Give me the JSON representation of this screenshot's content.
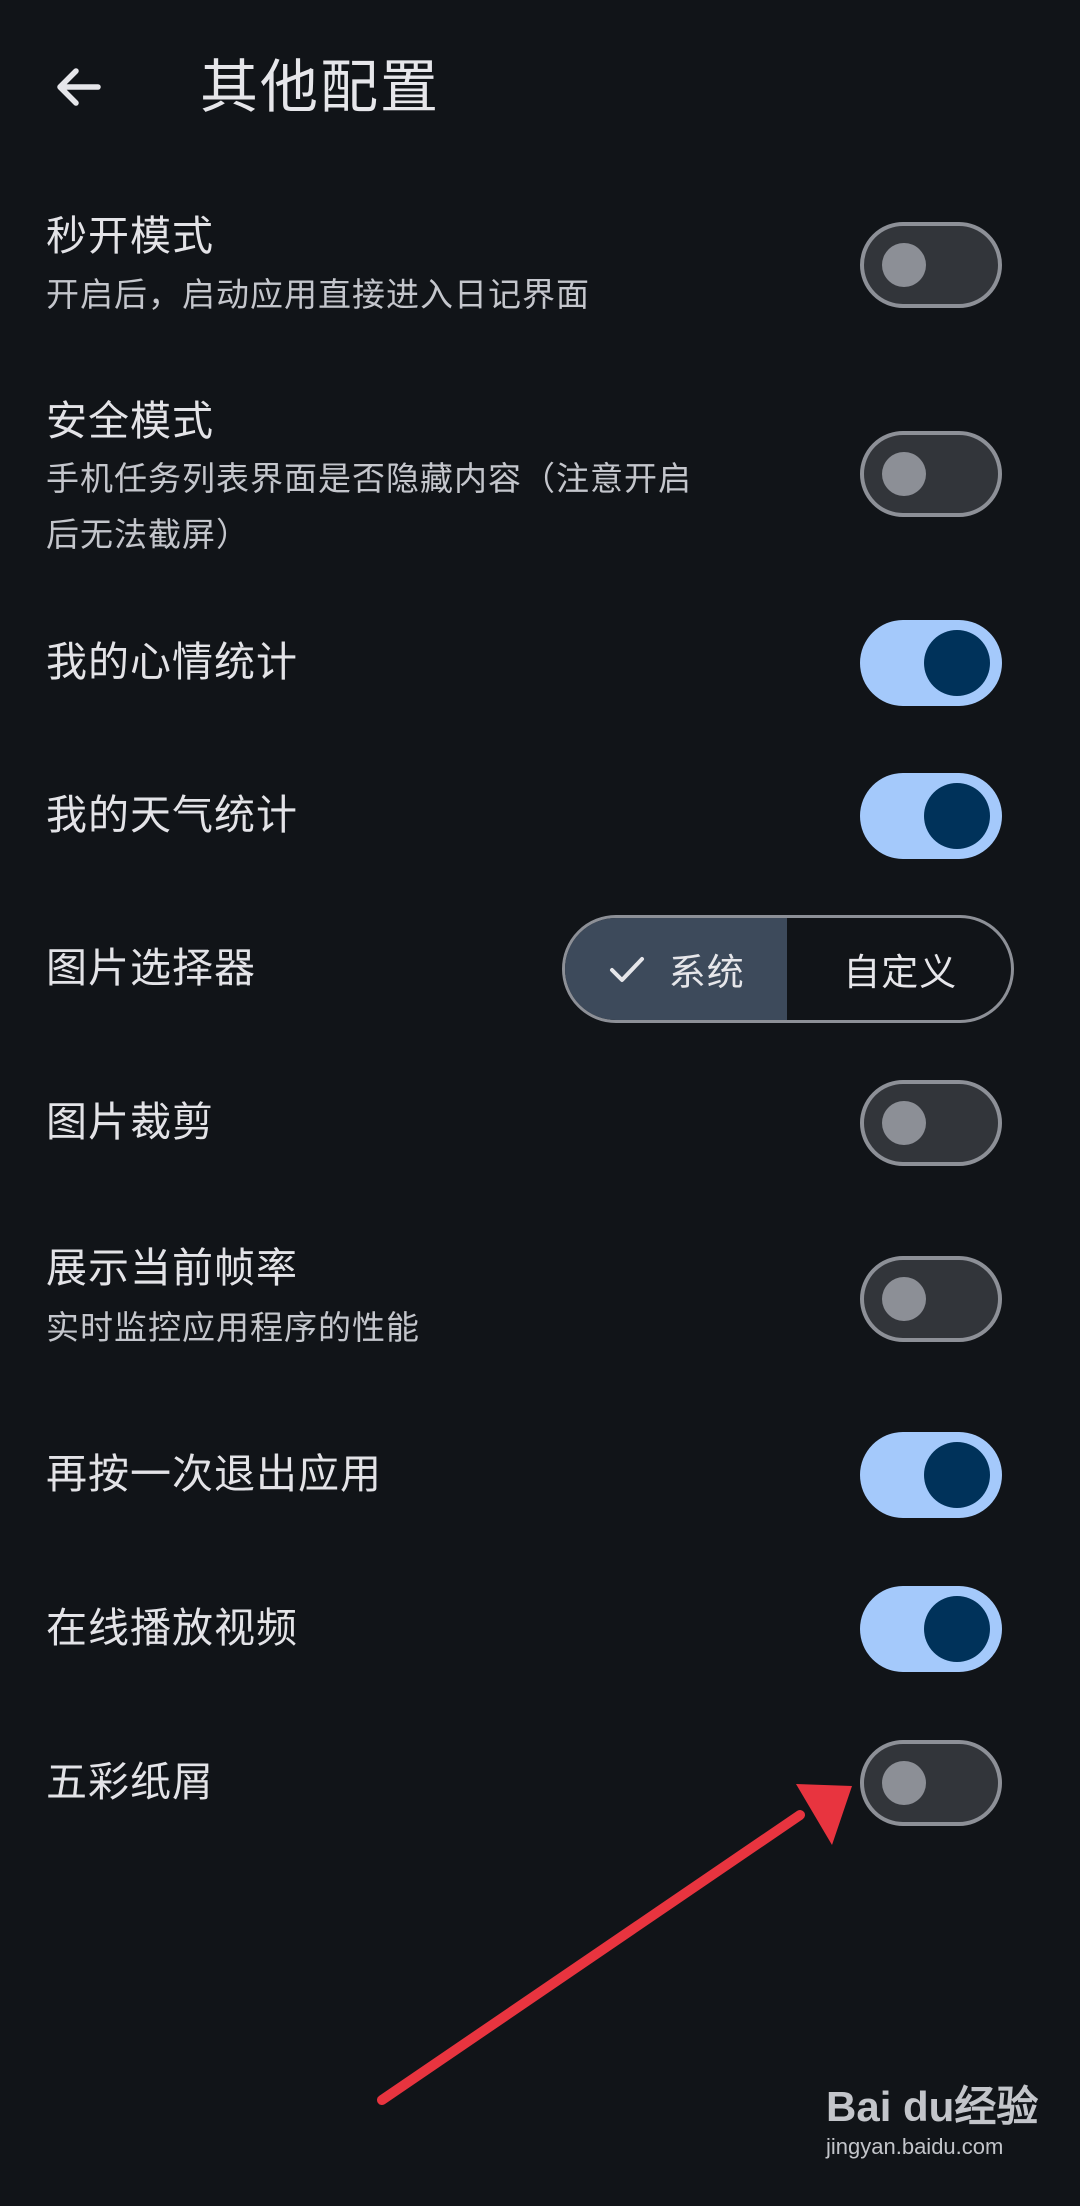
{
  "header": {
    "title": "其他配置",
    "back_icon": "arrow-left-icon"
  },
  "settings": [
    {
      "title": "秒开模式",
      "subtitle": "开启后，启动应用直接进入日记界面",
      "enabled": false
    },
    {
      "title": "安全模式",
      "subtitle_line1": "手机任务列表界面是否隐藏内容（注意开启",
      "subtitle_line2": "后无法截屏）",
      "enabled": false
    },
    {
      "title": "我的心情统计",
      "enabled": true
    },
    {
      "title": "我的天气统计",
      "enabled": true
    },
    {
      "title": "图片选择器",
      "options": [
        "系统",
        "自定义"
      ],
      "selected": "系统"
    },
    {
      "title": "图片裁剪",
      "enabled": false
    },
    {
      "title": "展示当前帧率",
      "subtitle": "实时监控应用程序的性能",
      "enabled": false
    },
    {
      "title": "再按一次退出应用",
      "enabled": true
    },
    {
      "title": "在线播放视频",
      "enabled": true
    },
    {
      "title": "五彩纸屑",
      "enabled": false
    }
  ],
  "watermark": {
    "logo": "Bai du经验",
    "url": "jingyan.baidu.com"
  },
  "colors": {
    "background": "#111418",
    "switch_on_track": "#a4c9fb",
    "switch_on_knob": "#00325a",
    "switch_off_track": "#32353a",
    "annotation_arrow": "#e8343f"
  }
}
